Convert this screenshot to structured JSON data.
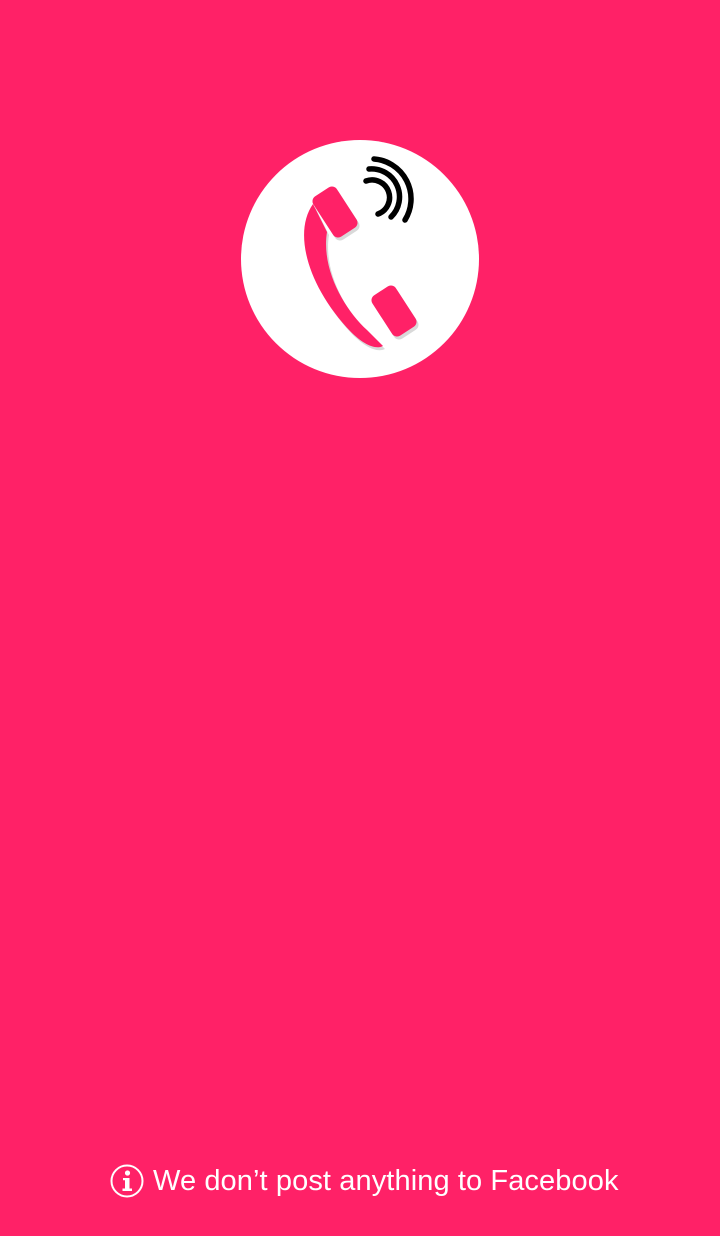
{
  "theme": {
    "background": "#ff2167",
    "logo_background": "#ffffff",
    "phone_color": "#ff2167",
    "signal_color": "#000000",
    "text_color": "#ffffff"
  },
  "logo": {
    "icon": "phone-ringing-icon"
  },
  "footer": {
    "icon": "info-icon",
    "notice": "We don’t post anything to Facebook"
  }
}
